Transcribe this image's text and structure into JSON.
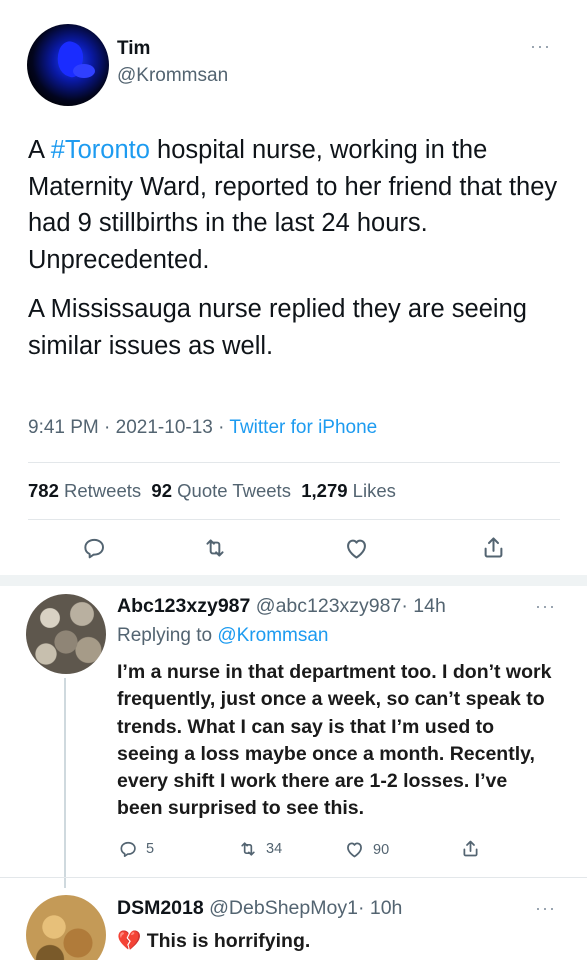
{
  "main_tweet": {
    "name": "Tim",
    "handle": "@Krommsan",
    "more": "···",
    "p1_pre": "A ",
    "p1_hashtag": "#Toronto",
    "p1_post": " hospital nurse, working in the Maternity Ward, reported to her friend that they had 9 stillbirths in the last 24 hours.  Unprecedented.",
    "p2": "A Mississauga nurse replied they are seeing similar issues as well.",
    "time": "9:41 PM",
    "date": "2021-10-13",
    "dot": " · ",
    "source": "Twitter for iPhone",
    "retweets_count": "782",
    "retweets_label": "Retweets",
    "quotes_count": "92",
    "quotes_label": "Quote Tweets",
    "likes_count": "1,279",
    "likes_label": "Likes",
    "icons": [
      "reply-icon",
      "retweet-icon",
      "like-icon",
      "share-icon"
    ]
  },
  "replies": [
    {
      "name": "Abc123xzy987",
      "handle": "@abc123xzy987",
      "time": "· 14h",
      "more": "···",
      "replying_label": "Replying to",
      "replying_handle": "@Krommsan",
      "text": "I’m a nurse in that department too. I don’t work frequently, just once a week, so can’t speak to trends. What I can say is that I’m used to seeing a loss maybe once a month. Recently, every shift I work there are 1-2 losses. I’ve been surprised to see this.",
      "replies": "5",
      "retweets": "34",
      "likes": "90"
    },
    {
      "name": "DSM2018",
      "handle": "@DebShepMoy1",
      "time": "· 10h",
      "more": "···",
      "emoji": "💔",
      "text": "This is horrifying."
    }
  ],
  "colors": {
    "accent": "#1d9bf0",
    "secondary_text": "#536471",
    "icon": "#536471",
    "broken_heart": "#c0182b"
  }
}
